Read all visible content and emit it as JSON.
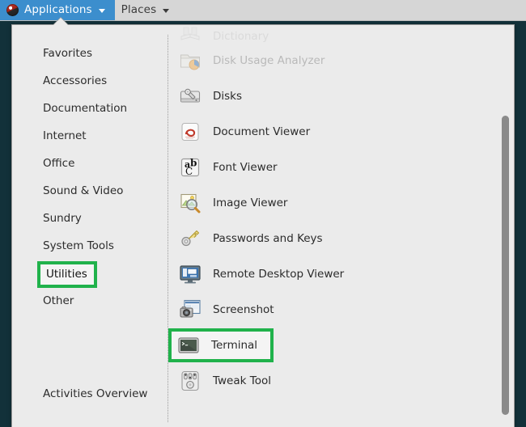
{
  "panel": {
    "logo_icon": "distro-logo-icon",
    "applications": {
      "label": "Applications",
      "caret_icon": "chevron-down-icon"
    },
    "places": {
      "label": "Places",
      "caret_icon": "chevron-down-icon"
    }
  },
  "menu": {
    "sidebar": {
      "items": [
        {
          "label": "Favorites",
          "highlighted": false
        },
        {
          "label": "Accessories",
          "highlighted": false
        },
        {
          "label": "Documentation",
          "highlighted": false
        },
        {
          "label": "Internet",
          "highlighted": false
        },
        {
          "label": "Office",
          "highlighted": false
        },
        {
          "label": "Sound & Video",
          "highlighted": false
        },
        {
          "label": "Sundry",
          "highlighted": false
        },
        {
          "label": "System Tools",
          "highlighted": false
        },
        {
          "label": "Utilities",
          "highlighted": true
        },
        {
          "label": "Other",
          "highlighted": false
        }
      ],
      "activities_label": "Activities Overview"
    },
    "applications": [
      {
        "label": "Dictionary",
        "icon": "dictionary-icon",
        "state": "clipped"
      },
      {
        "label": "Disk Usage Analyzer",
        "icon": "disk-usage-analyzer-icon",
        "state": "faded"
      },
      {
        "label": "Disks",
        "icon": "disks-icon",
        "state": "normal"
      },
      {
        "label": "Document Viewer",
        "icon": "document-viewer-icon",
        "state": "normal"
      },
      {
        "label": "Font Viewer",
        "icon": "font-viewer-icon",
        "state": "normal"
      },
      {
        "label": "Image Viewer",
        "icon": "image-viewer-icon",
        "state": "normal"
      },
      {
        "label": "Passwords and Keys",
        "icon": "passwords-and-keys-icon",
        "state": "normal"
      },
      {
        "label": "Remote Desktop Viewer",
        "icon": "remote-desktop-viewer-icon",
        "state": "normal"
      },
      {
        "label": "Screenshot",
        "icon": "screenshot-icon",
        "state": "normal"
      },
      {
        "label": "Terminal",
        "icon": "terminal-icon",
        "state": "boxed"
      },
      {
        "label": "Tweak Tool",
        "icon": "tweak-tool-icon",
        "state": "normal"
      }
    ]
  },
  "colors": {
    "panel_active": "#3c8ecd",
    "panel_background": "#d6d6d6",
    "menu_background": "#ebebeb",
    "highlight_green": "#20b24b",
    "desktop": "#12313a"
  }
}
